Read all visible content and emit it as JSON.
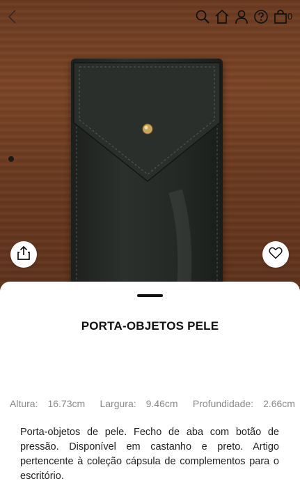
{
  "header": {
    "back_icon": "chevron-left-icon",
    "icons": [
      "search-icon",
      "home-icon",
      "user-icon",
      "help-icon",
      "bag-icon"
    ],
    "bag_count": "0"
  },
  "gallery": {
    "share_icon": "share-icon",
    "wishlist_icon": "heart-icon"
  },
  "product": {
    "title": "PORTA-OBJETOS PELE",
    "dimensions": [
      {
        "label": "Altura:",
        "value": "16.73cm"
      },
      {
        "label": "Largura:",
        "value": "9.46cm"
      },
      {
        "label": "Profundidade:",
        "value": "2.66cm"
      }
    ],
    "description": "Porta-objetos de pele. Fecho de aba com botão de pressão. Disponível em castanho e preto. Artigo pertencente à coleção cápsula de complementos para o escritório."
  },
  "colors": {
    "wood": "#6b3a20",
    "leather": "#252925",
    "text": "#111111",
    "muted": "#8a8a8a"
  }
}
